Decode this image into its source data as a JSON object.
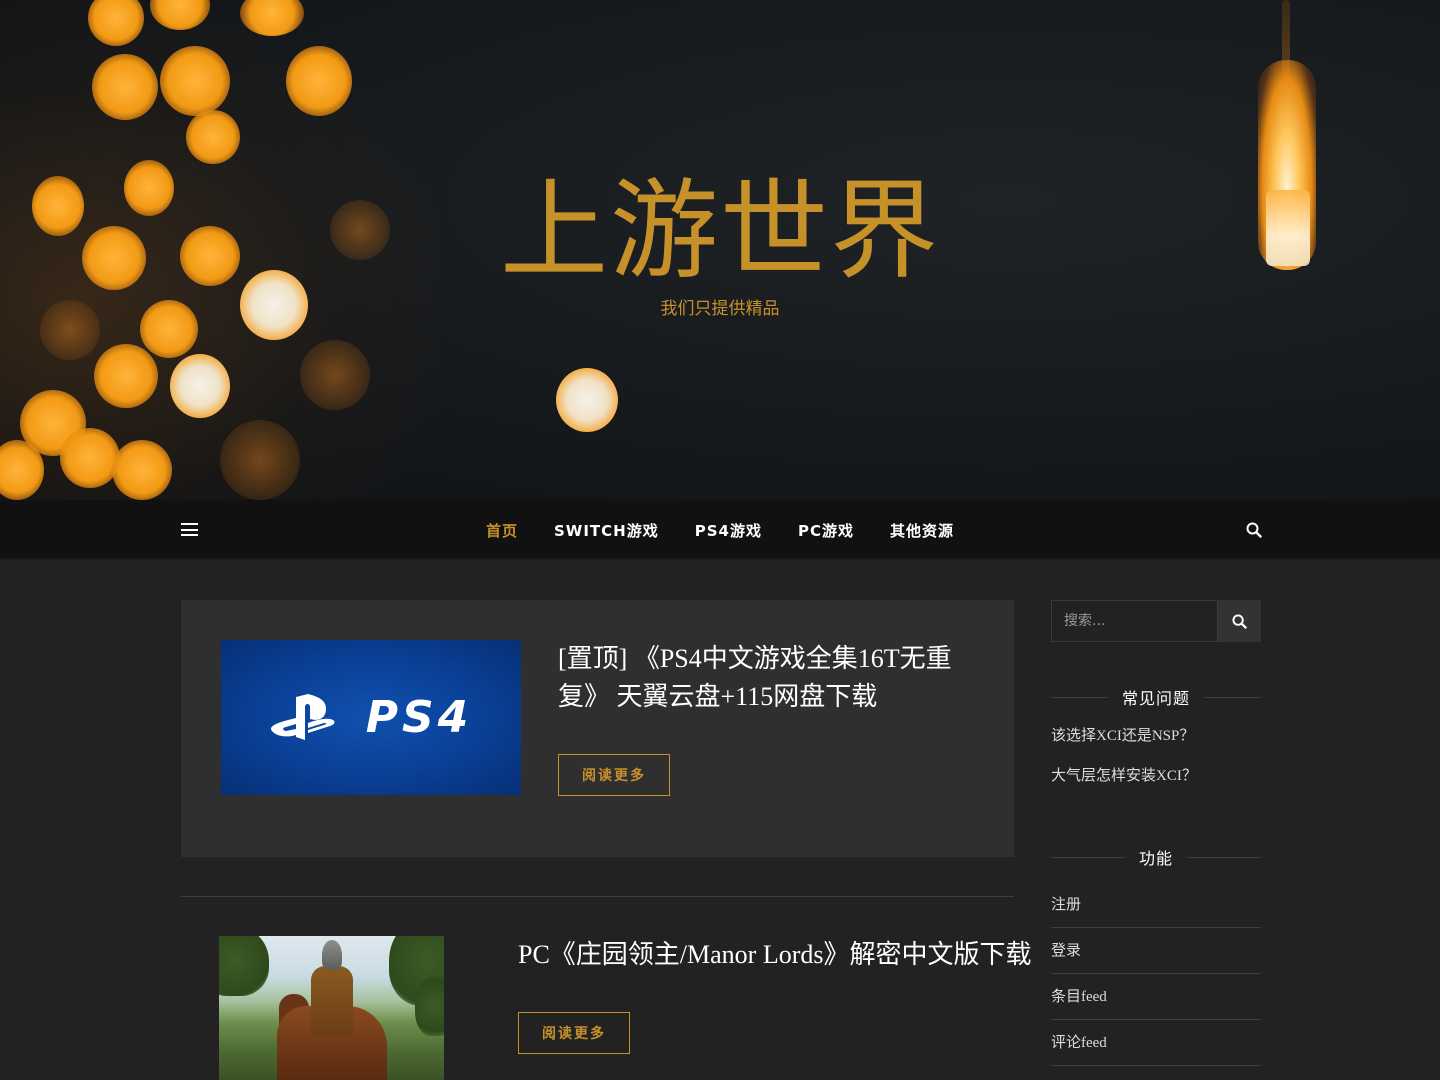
{
  "site": {
    "title": "上游世界",
    "tagline": "我们只提供精品"
  },
  "nav": {
    "items": [
      {
        "label": "首页",
        "active": true
      },
      {
        "label": "SWITCH游戏",
        "active": false
      },
      {
        "label": "PS4游戏",
        "active": false
      },
      {
        "label": "PC游戏",
        "active": false
      },
      {
        "label": "其他资源",
        "active": false
      }
    ],
    "menu_icon": "hamburger-menu-icon",
    "search_icon": "search-icon"
  },
  "posts": [
    {
      "title_line1": "[置顶] 《PS4中文游戏全集16T无重",
      "title_line2": "复》 天翼云盘+115网盘下载",
      "read_more": "阅读更多",
      "thumb_text": "PS4"
    },
    {
      "title": "PC《庄园领主/Manor Lords》解密中文版下载",
      "read_more": "阅读更多"
    }
  ],
  "sidebar": {
    "search_placeholder": "搜索...",
    "faq": {
      "title": "常见问题",
      "links": [
        "该选择XCI还是NSP？",
        "大气层怎样安装XCI？"
      ]
    },
    "functions": {
      "title": "功能",
      "items": [
        "注册",
        "登录",
        "条目feed",
        "评论feed"
      ]
    }
  },
  "colors": {
    "accent": "#c7912a",
    "background": "#222222",
    "nav_background": "#111111",
    "card_background": "#2f2f2f"
  }
}
